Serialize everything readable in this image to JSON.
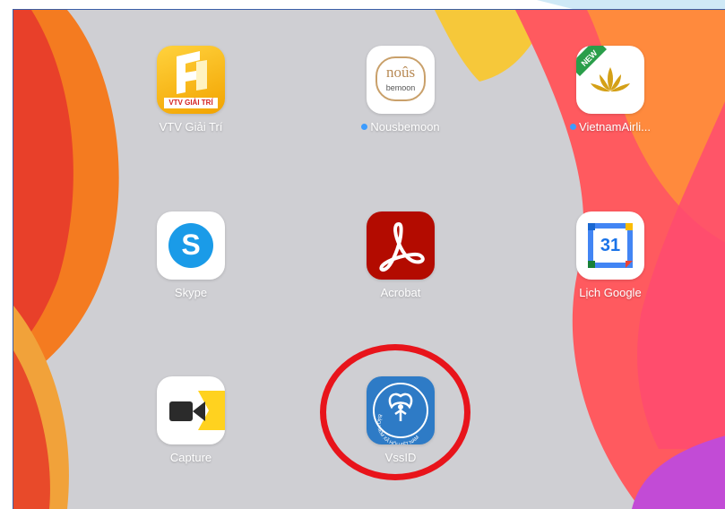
{
  "apps": [
    {
      "label": "VTV Giải Trí",
      "brand_text": "VTV GIẢI TRÍ",
      "icon": "vtv-giai-tri-icon",
      "color": "#f6b400"
    },
    {
      "label": "Nousbemoon",
      "brand_top": "noûs",
      "brand_bottom": "bemoon",
      "icon": "nousbemoon-icon",
      "color": "#d9a96a",
      "status_dot": true
    },
    {
      "label": "VietnamAirli...",
      "badge": "NEW",
      "icon": "vietnam-airlines-lotus-icon",
      "color": "#d4a017",
      "status_dot": true
    },
    {
      "label": "Skype",
      "glyph": "S",
      "icon": "skype-icon",
      "color": "#1a9be8"
    },
    {
      "label": "Acrobat",
      "icon": "adobe-acrobat-icon",
      "color": "#b30b00"
    },
    {
      "label": "Lịch Google",
      "glyph": "31",
      "icon": "google-calendar-icon",
      "color": "#4285f4"
    },
    {
      "label": "Capture",
      "icon": "capture-camera-icon",
      "color": "#ffd21f"
    },
    {
      "label": "VssID",
      "ring_text": "BẢO HIỂM XÃ HỘI VIỆT NAM",
      "icon": "vssid-social-insurance-icon",
      "color": "#2e7bc6"
    }
  ],
  "annotation": {
    "color": "#e8141b",
    "target": "VssID"
  }
}
